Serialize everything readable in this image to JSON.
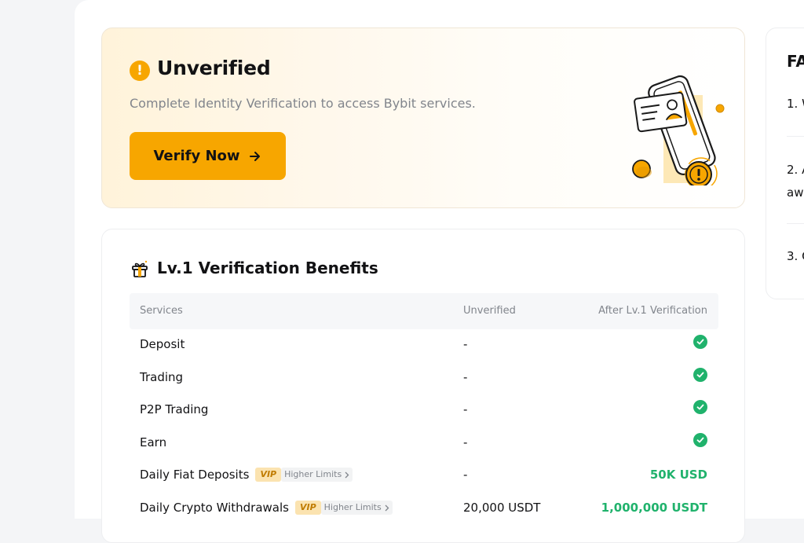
{
  "status_card": {
    "icon": "exclamation-circle-icon",
    "title": "Unverified",
    "description": "Complete Identity Verification to access Bybit services.",
    "verify_button_label": "Verify Now",
    "accent_color": "#f7a600"
  },
  "benefits": {
    "title": "Lv.1 Verification Benefits",
    "columns": {
      "service": "Services",
      "unverified": "Unverified",
      "after": "After Lv.1 Verification"
    },
    "rows": [
      {
        "service": "Deposit",
        "unverified": "-",
        "after": "check"
      },
      {
        "service": "Trading",
        "unverified": "-",
        "after": "check"
      },
      {
        "service": "P2P Trading",
        "unverified": "-",
        "after": "check"
      },
      {
        "service": "Earn",
        "unverified": "-",
        "after": "check"
      },
      {
        "service": "Daily Fiat Deposits",
        "vip": "VIP",
        "higher_limits": "Higher Limits",
        "unverified": "-",
        "after": "50K USD"
      },
      {
        "service": "Daily Crypto Withdrawals",
        "vip": "VIP",
        "higher_limits": "Higher Limits",
        "unverified": "20,000 USDT",
        "after": "1,000,000 USDT"
      }
    ],
    "success_color": "#20b26c"
  },
  "faq": {
    "title": "FA",
    "items": [
      "1. W",
      "2. A",
      "3. C"
    ],
    "item2_continuation": "aw"
  }
}
